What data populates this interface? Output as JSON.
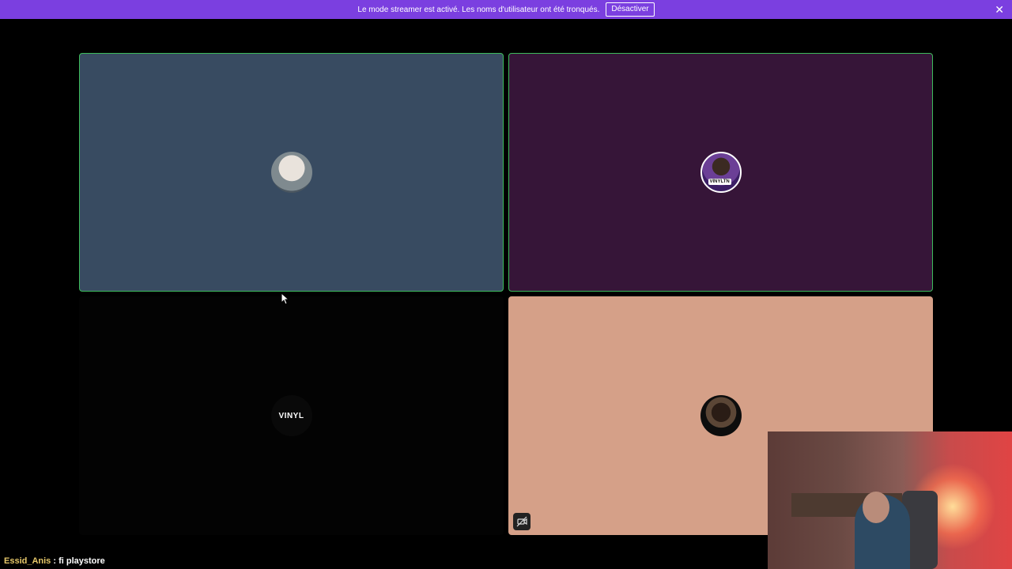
{
  "banner": {
    "message": "Le mode streamer est activé. Les noms d'utilisateur ont été tronqués.",
    "button_label": "Désactiver",
    "close_symbol": "✕"
  },
  "tiles": [
    {
      "id": "tile-1",
      "speaking": true,
      "background": "#384b61",
      "avatar_icon": "group-photo-avatar"
    },
    {
      "id": "tile-2",
      "speaking": true,
      "background": "#361538",
      "avatar_icon": "vinyl-user-avatar",
      "avatar_tag": "VINYLTN"
    },
    {
      "id": "tile-3",
      "speaking": false,
      "background": "#030303",
      "avatar_text": "VINYL"
    },
    {
      "id": "tile-4",
      "speaking": false,
      "background": "#d5a088",
      "avatar_icon": "glasses-user-avatar",
      "overlay_icon": "camera-off-icon"
    }
  ],
  "chat": {
    "username": "Essid_Anis",
    "separator": " : ",
    "message": "fi playstore"
  },
  "colors": {
    "banner": "#7b3fe0",
    "speaking_border": "#3dbb5b"
  }
}
